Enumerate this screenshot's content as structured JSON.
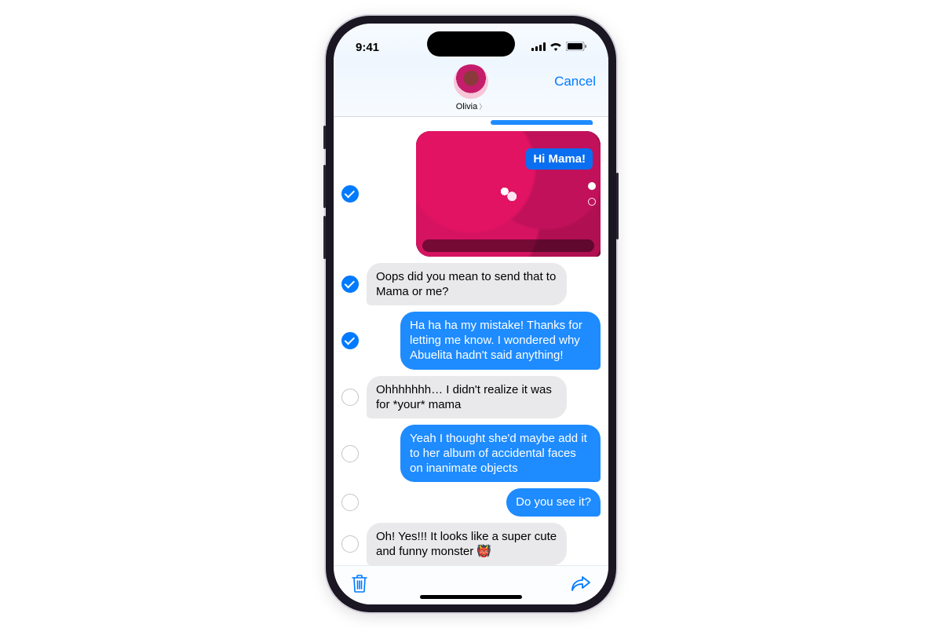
{
  "status": {
    "time": "9:41"
  },
  "header": {
    "contact_name": "Olivia",
    "cancel_label": "Cancel"
  },
  "photo_caption": "Hi Mama!",
  "messages": [
    {
      "type": "photo",
      "direction": "out",
      "selected": true
    },
    {
      "direction": "in",
      "selected": true,
      "text": "Oops did you mean to send that to Mama or me?"
    },
    {
      "direction": "out",
      "selected": true,
      "text": "Ha ha ha my mistake! Thanks for letting me know. I wondered why Abuelita hadn't said anything!"
    },
    {
      "direction": "in",
      "selected": false,
      "text": "Ohhhhhhh… I didn't realize it was for *your* mama"
    },
    {
      "direction": "out",
      "selected": false,
      "text": "Yeah I thought she'd maybe add it to her album of accidental faces on inanimate objects"
    },
    {
      "direction": "out",
      "selected": false,
      "text": "Do you see it?"
    },
    {
      "direction": "in",
      "selected": false,
      "text": "Oh! Yes!!! It looks like a super cute and funny monster 👹"
    }
  ],
  "selector_rows": [
    true,
    true,
    true,
    false,
    false,
    false,
    false
  ]
}
